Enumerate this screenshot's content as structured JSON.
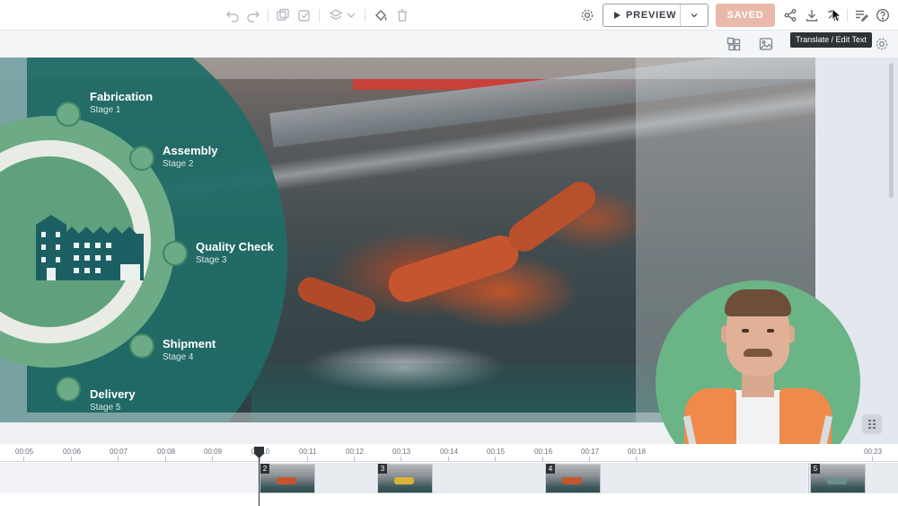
{
  "toolbar": {
    "icons": [
      "undo-icon",
      "redo-icon",
      "duplicate-icon",
      "copy-style-icon",
      "layers-icon",
      "chevron-down-icon",
      "fill-icon",
      "trash-icon",
      "settings-icon",
      "share-icon",
      "download-icon",
      "translate-icon",
      "script-icon",
      "help-icon"
    ],
    "preview_label": "PREVIEW",
    "saved_label": "SAVED"
  },
  "subbar": {
    "icons": [
      "layout-icon",
      "image-icon",
      "settings-icon"
    ],
    "tooltip": "Translate / Edit Text"
  },
  "infographic": {
    "stages": [
      {
        "title": "Fabrication",
        "subtitle": "Stage 1"
      },
      {
        "title": "Assembly",
        "subtitle": "Stage 2"
      },
      {
        "title": "Quality Check",
        "subtitle": "Stage 3"
      },
      {
        "title": "Shipment",
        "subtitle": "Stage 4"
      },
      {
        "title": "Delivery",
        "subtitle": "Stage 5"
      }
    ],
    "colors": {
      "teal": "#1f6d68",
      "green": "#6cab86",
      "track": "#e9ece4"
    }
  },
  "timeline": {
    "ticks": [
      "00:05",
      "00:06",
      "00:07",
      "00:08",
      "00:09",
      "00:10",
      "00:11",
      "00:12",
      "00:13",
      "00:14",
      "00:15",
      "00:16",
      "00:17",
      "00:18",
      "00:23"
    ],
    "scenes": [
      "2",
      "3",
      "4",
      "5"
    ]
  },
  "colors": {
    "saved": "#e9b9aa",
    "accent_dark": "#2f3237"
  }
}
